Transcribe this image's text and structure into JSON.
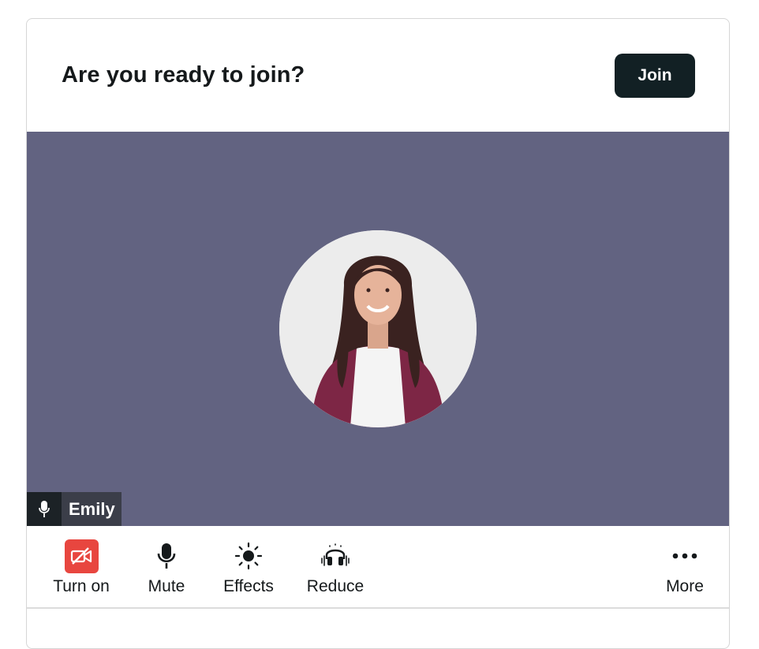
{
  "header": {
    "title": "Are you ready to join?",
    "join_label": "Join"
  },
  "video": {
    "participant_name": "Emily",
    "background_color": "#626381"
  },
  "toolbar": {
    "items": [
      {
        "label": "Turn on",
        "icon": "camera-off-icon",
        "accent": "#e8463f"
      },
      {
        "label": "Mute",
        "icon": "microphone-icon"
      },
      {
        "label": "Effects",
        "icon": "effects-icon"
      },
      {
        "label": "Reduce",
        "icon": "noise-reduction-icon"
      },
      {
        "label": "More",
        "icon": "more-icon"
      }
    ]
  },
  "colors": {
    "join_button": "#122024",
    "camera_off": "#e8463f",
    "text": "#15191b"
  }
}
